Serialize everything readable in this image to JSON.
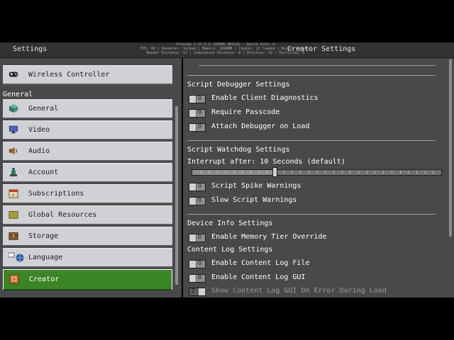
{
  "header": {
    "left_title": "Settings",
    "center_title": "Creator Settings",
    "debug_lines": [
      "Preview 1.21.X.X (DEBUG BUILD) - Build Info: X",
      "FPS: 60 | Renderer: Vulkan | Memory: 2048MB | Chunks: 12 loaded | Build: Release",
      "Render Distance: 12 | Simulation Distance: 8 | Entities: 42 | Particles: 0"
    ]
  },
  "sidebar": {
    "top_item": {
      "label": "Wireless Controller",
      "icon": "gamepad-icon"
    },
    "section_label": "General",
    "items": [
      {
        "label": "General",
        "icon": "cube-icon"
      },
      {
        "label": "Video",
        "icon": "monitor-icon"
      },
      {
        "label": "Audio",
        "icon": "speaker-icon"
      },
      {
        "label": "Account",
        "icon": "person-icon"
      },
      {
        "label": "Subscriptions",
        "icon": "calendar-icon"
      },
      {
        "label": "Global Resources",
        "icon": "package-icon"
      },
      {
        "label": "Storage",
        "icon": "chest-icon"
      },
      {
        "label": "Language",
        "icon": "globe-icon"
      },
      {
        "label": "Creator",
        "icon": "creator-icon",
        "active": true
      }
    ]
  },
  "content": {
    "script_debugger": {
      "heading": "Script Debugger Settings",
      "toggles": [
        {
          "label": "Enable Client Diagnostics",
          "state": "O"
        },
        {
          "label": "Require Passcode",
          "state": "O"
        },
        {
          "label": "Attach Debugger on Load",
          "state": "O"
        }
      ]
    },
    "script_watchdog": {
      "heading": "Script Watchdog Settings",
      "interrupt_label": "Interrupt after: 10 Seconds (default)",
      "slider_value": 10,
      "slider_max": 30,
      "toggles": [
        {
          "label": "Script Spike Warnings",
          "state": "O"
        },
        {
          "label": "Slow Script Warnings",
          "state": "O"
        }
      ]
    },
    "device_info": {
      "heading": "Device Info Settings",
      "toggles": [
        {
          "label": "Enable Memory Tier Override",
          "state": "O"
        }
      ]
    },
    "content_log": {
      "heading": "Content Log Settings",
      "toggles": [
        {
          "label": "Enable Content Log File",
          "state": "O"
        },
        {
          "label": "Enable Content Log GUI",
          "state": "O"
        },
        {
          "label": "Show Content Log GUI On Error During Load",
          "state": "I",
          "disabled": true
        }
      ]
    }
  },
  "colors": {
    "panel_bg": "#48494a",
    "button_bg": "#d0d1d4",
    "active_green": "#3c8527",
    "topbar_bg": "#313233"
  }
}
